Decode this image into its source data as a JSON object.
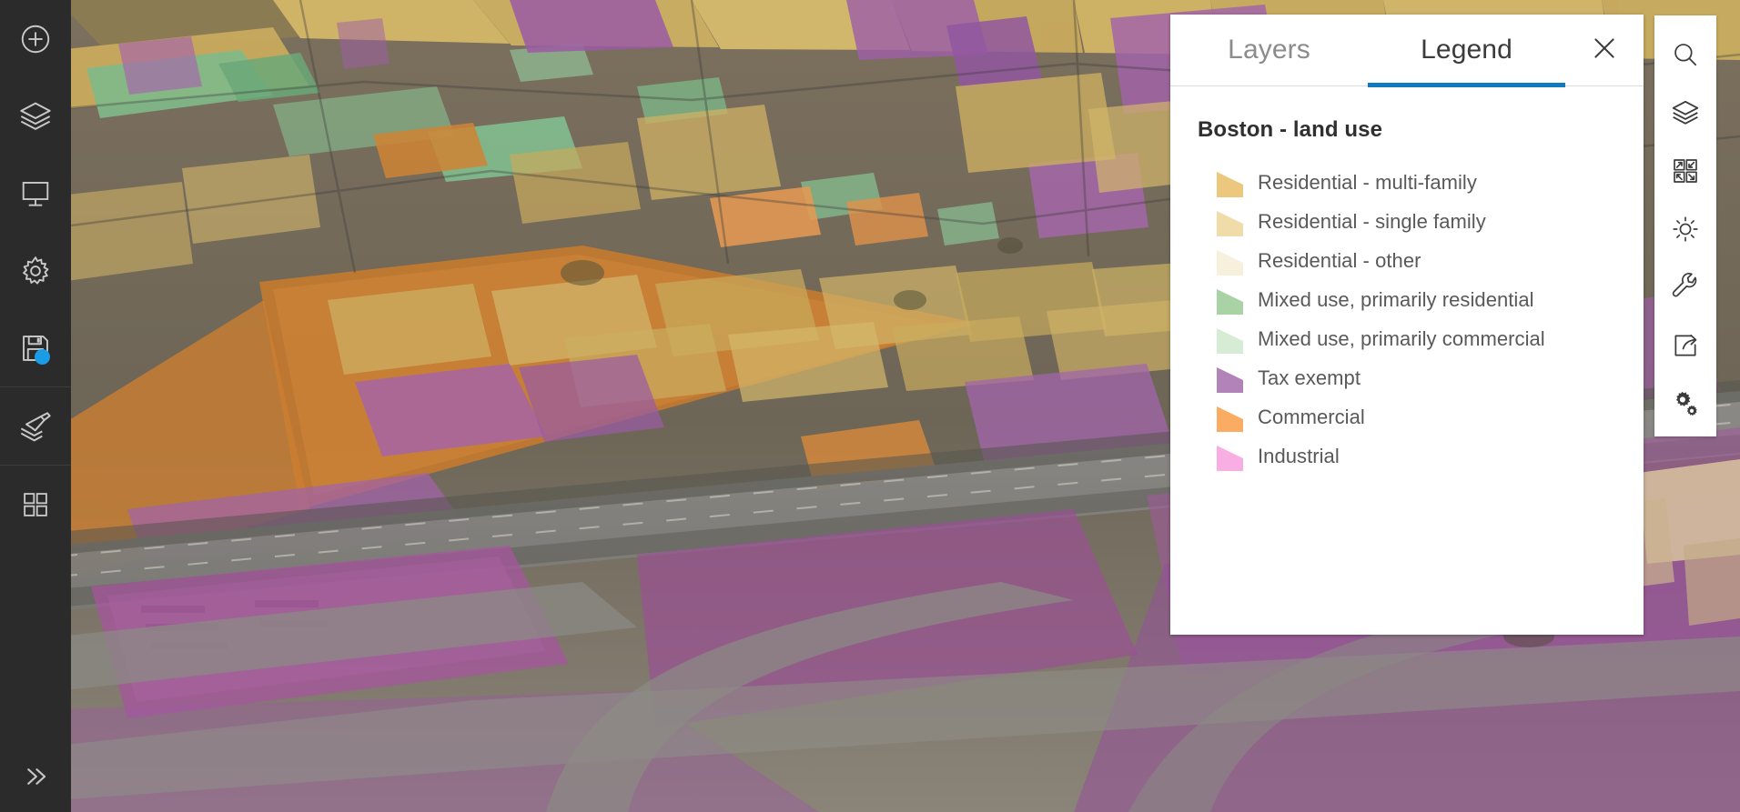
{
  "app": {
    "background_description": "3D aerial scene of Boston with buildings symbolized by land use"
  },
  "left_toolbar": {
    "items": [
      {
        "name": "add-layer",
        "icon": "plus-circle-icon",
        "label": "Add"
      },
      {
        "name": "layers",
        "icon": "layers-icon",
        "label": "Layers"
      },
      {
        "name": "slides",
        "icon": "presentation-icon",
        "label": "Slides"
      },
      {
        "name": "settings",
        "icon": "gear-icon",
        "label": "Settings"
      },
      {
        "name": "save",
        "icon": "floppy-disk-icon",
        "label": "Save",
        "badge": true
      },
      {
        "name": "edit-layer",
        "icon": "layers-pencil-icon",
        "label": "Edit"
      },
      {
        "name": "apps",
        "icon": "grid-squares-icon",
        "label": "Apps"
      }
    ],
    "expand": {
      "name": "expand-rail",
      "icon": "double-chevron-right-icon",
      "label": ">>"
    },
    "badge_color": "#1b9ce6",
    "background_color": "#2b2b2b"
  },
  "right_toolbar": {
    "items": [
      {
        "name": "search",
        "icon": "search-icon",
        "label": "Search"
      },
      {
        "name": "layer-list",
        "icon": "layers-icon",
        "label": "Layers"
      },
      {
        "name": "basemap",
        "icon": "basemap-grid-icon",
        "label": "Basemap"
      },
      {
        "name": "daylight",
        "icon": "sun-icon",
        "label": "Daylight"
      },
      {
        "name": "measure",
        "icon": "wrench-icon",
        "label": "Measure"
      },
      {
        "name": "share",
        "icon": "share-box-arrow-icon",
        "label": "Share"
      },
      {
        "name": "settings",
        "icon": "double-gear-icon",
        "label": "Settings"
      }
    ],
    "background_color": "#ffffff"
  },
  "panel": {
    "tabs": [
      {
        "id": "layers",
        "label": "Layers",
        "active": false
      },
      {
        "id": "legend",
        "label": "Legend",
        "active": true
      }
    ],
    "active_tab_underline_color": "#1279c0",
    "close_label": "×",
    "legend": {
      "title": "Boston - land use",
      "items": [
        {
          "label": "Residential - multi-family",
          "color": "#ecc87e"
        },
        {
          "label": "Residential - single family",
          "color": "#f0dca8"
        },
        {
          "label": "Residential - other",
          "color": "#f7f0dc"
        },
        {
          "label": "Mixed use, primarily residential",
          "color": "#a9d3a4"
        },
        {
          "label": "Mixed use, primarily commercial",
          "color": "#d7ecd4"
        },
        {
          "label": "Tax exempt",
          "color": "#b183b8"
        },
        {
          "label": "Commercial",
          "color": "#f9ac62"
        },
        {
          "label": "Industrial",
          "color": "#f8aee2"
        }
      ]
    }
  },
  "chart_data": {
    "type": "table",
    "title": "Boston - land use",
    "categories": [
      "Residential - multi-family",
      "Residential - single family",
      "Residential - other",
      "Mixed use, primarily residential",
      "Mixed use, primarily commercial",
      "Tax exempt",
      "Commercial",
      "Industrial"
    ],
    "colors": [
      "#ecc87e",
      "#f0dca8",
      "#f7f0dc",
      "#a9d3a4",
      "#d7ecd4",
      "#b183b8",
      "#f9ac62",
      "#f8aee2"
    ]
  }
}
